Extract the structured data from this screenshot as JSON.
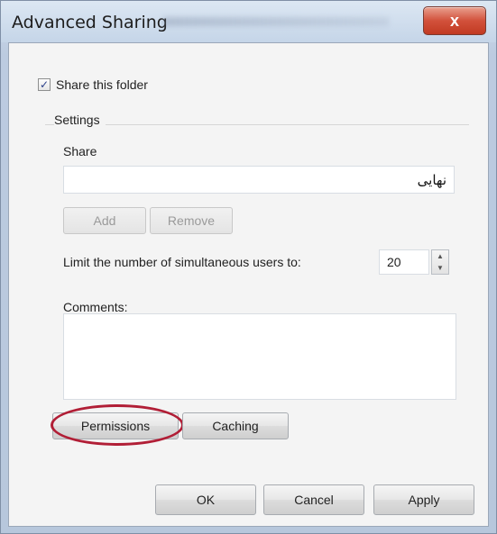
{
  "window": {
    "title": "Advanced Sharing",
    "close_glyph": "x"
  },
  "share_folder": {
    "checked": true,
    "check_glyph": "✓",
    "label": "Share this folder"
  },
  "settings": {
    "group_label": "Settings",
    "share_label": "Share",
    "share_value": "نهایی",
    "add_label": "Add",
    "remove_label": "Remove",
    "limit_label": "Limit the number of simultaneous users to:",
    "limit_value": "20",
    "comments_label": "Comments:",
    "comments_value": ""
  },
  "buttons": {
    "permissions": "Permissions",
    "caching": "Caching",
    "ok": "OK",
    "cancel": "Cancel",
    "apply": "Apply"
  },
  "colors": {
    "highlight": "#b11e36",
    "close_button": "#d2513b"
  }
}
